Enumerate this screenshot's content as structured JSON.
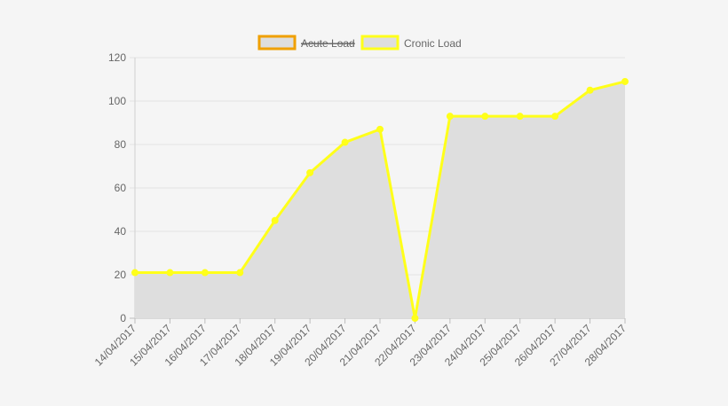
{
  "chart_data": {
    "type": "area",
    "categories": [
      "14/04/2017",
      "15/04/2017",
      "16/04/2017",
      "17/04/2017",
      "18/04/2017",
      "19/04/2017",
      "20/04/2017",
      "21/04/2017",
      "22/04/2017",
      "23/04/2017",
      "24/04/2017",
      "25/04/2017",
      "26/04/2017",
      "27/04/2017",
      "28/04/2017"
    ],
    "series": [
      {
        "name": "Acute Load",
        "hidden": true,
        "values": [],
        "stroke_color": "#f0a000",
        "fill_color": "#dedede"
      },
      {
        "name": "Cronic Load",
        "hidden": false,
        "values": [
          21,
          21,
          21,
          21,
          45,
          67,
          81,
          87,
          0,
          93,
          93,
          93,
          93,
          105,
          109
        ],
        "stroke_color": "#ffff1a",
        "fill_color": "#dedede"
      }
    ],
    "title": "",
    "xlabel": "",
    "ylabel": "",
    "ylim": [
      0,
      120
    ],
    "yticks": [
      0,
      20,
      40,
      60,
      80,
      100,
      120
    ],
    "grid": true,
    "legend_position": "top-center"
  }
}
